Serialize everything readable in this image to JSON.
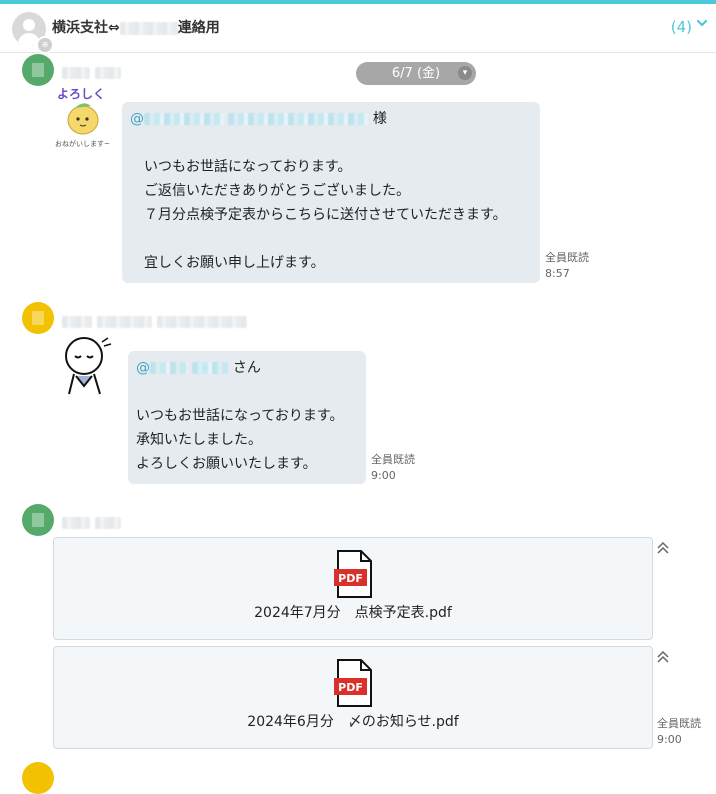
{
  "header": {
    "title_prefix": "横浜支社⇔",
    "title_suffix": "連絡用",
    "count": "(4)",
    "chevron": "chevron-down-icon"
  },
  "date_divider": {
    "label": "6/7 (金)"
  },
  "messages": [
    {
      "sticker_text_top": "よろしく",
      "sticker_text_bottom": "おねがいします~",
      "mention_prefix": "@",
      "mention_suffix": "様",
      "lines": [
        "いつもお世話になっております。",
        "ご返信いただきありがとうございました。",
        "７月分点検予定表からこちらに送付させていただきます。",
        "宜しくお願い申し上げます。"
      ],
      "read_status": "全員既読",
      "time": "8:57"
    },
    {
      "mention_prefix": "@",
      "mention_suffix": "さん",
      "lines": [
        "いつもお世話になっております。",
        "承知いたしました。",
        "よろしくお願いいたします。"
      ],
      "read_status": "全員既読",
      "time": "9:00"
    },
    {
      "files": [
        {
          "name": "2024年7月分　点検予定表.pdf",
          "type": "PDF"
        },
        {
          "name": "2024年6月分　〆のお知らせ.pdf",
          "type": "PDF"
        }
      ],
      "read_status": "全員既読",
      "time": "9:00"
    }
  ]
}
